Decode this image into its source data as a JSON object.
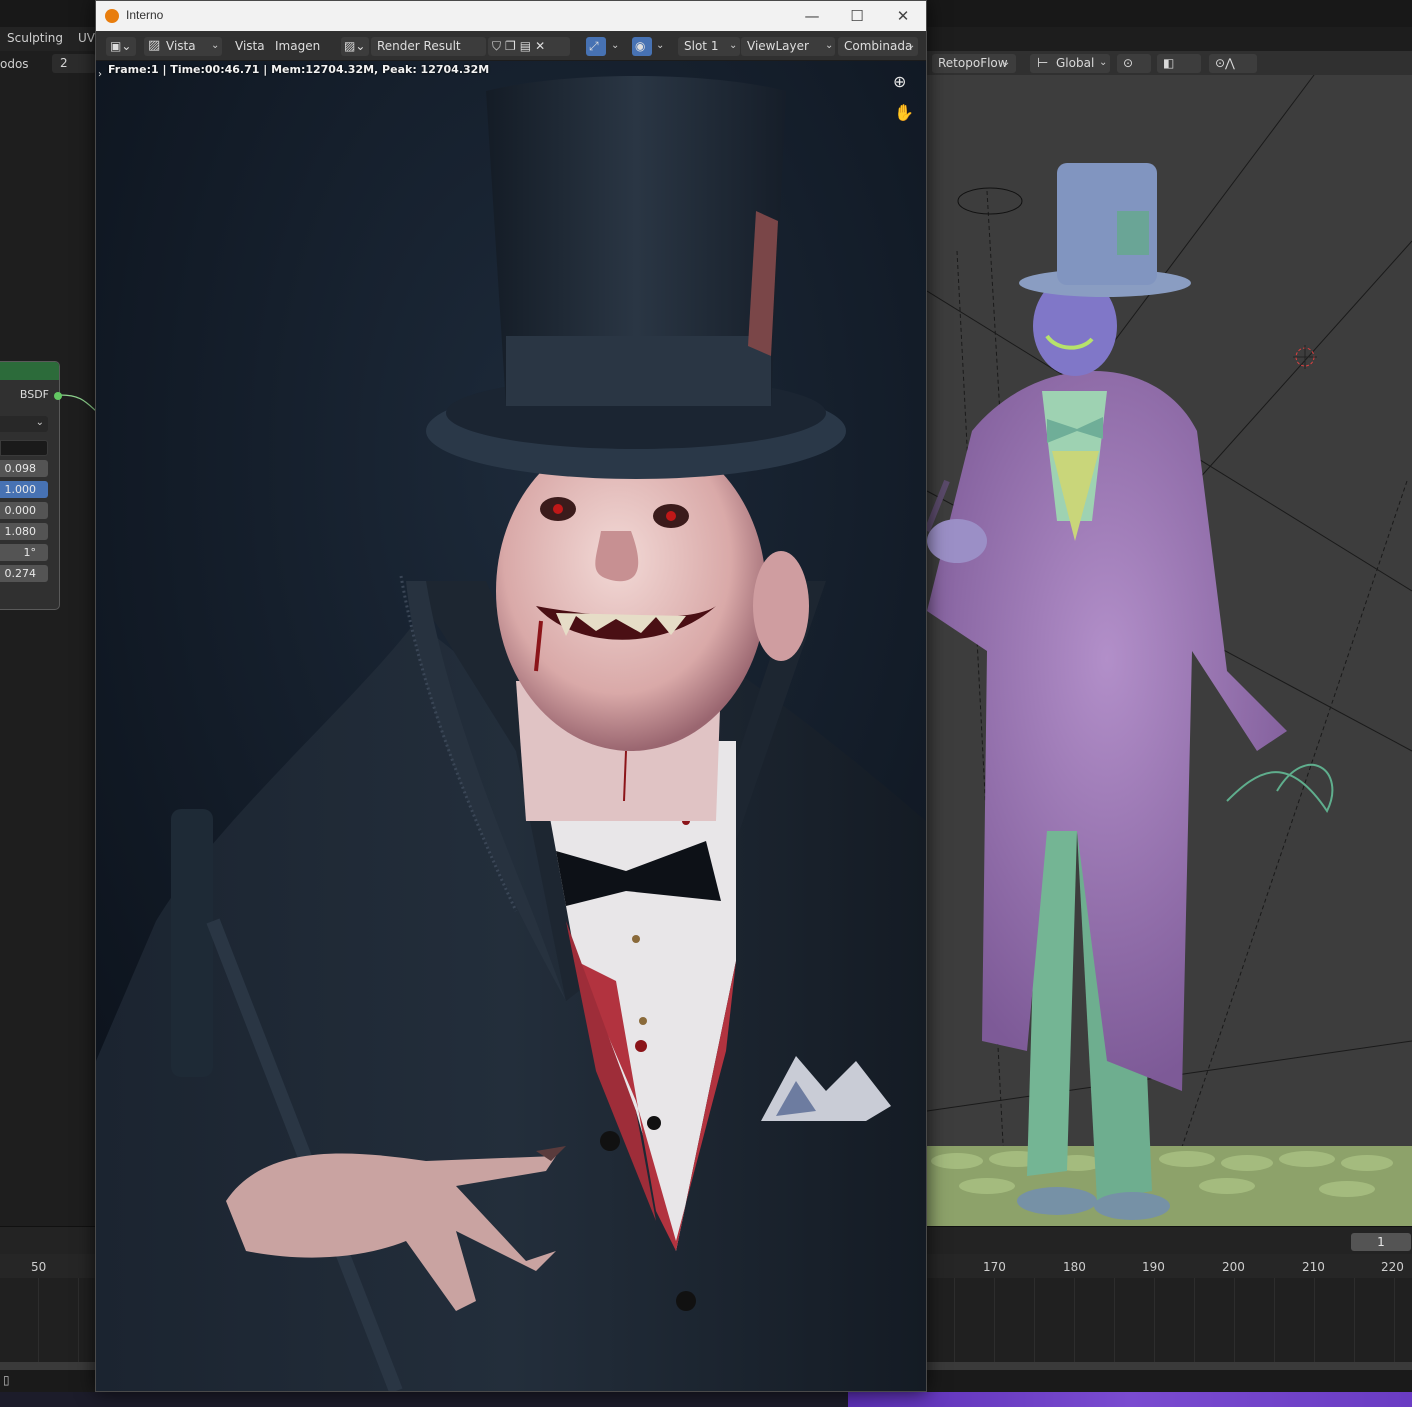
{
  "workspace": {
    "tabs": [
      "Sculpting",
      "UV"
    ],
    "left_header_label": "odos",
    "left_header_value": "2"
  },
  "node": {
    "output_label": "BSDF",
    "values": [
      "0.098",
      "1.000",
      "0.000",
      "1.080",
      "1°",
      "0.274"
    ],
    "active_index": 1,
    "header_color": "#2c6b3a"
  },
  "viewport": {
    "addon_menu": "RetopoFlow",
    "orientation": "Global"
  },
  "timeline": {
    "current_frame": "1",
    "ticks_left": [
      "50"
    ],
    "ticks_right": [
      "170",
      "180",
      "190",
      "200",
      "210",
      "220"
    ]
  },
  "render_window": {
    "title": "Interno",
    "header": {
      "view_menu_1": "Vista",
      "view_menu_2": "Vista",
      "image_menu": "Imagen",
      "image_name": "Render Result",
      "slot": "Slot 1",
      "view_layer": "ViewLayer",
      "pass": "Combinada"
    },
    "frame_info": "Frame:1 | Time:00:46.71 | Mem:12704.32M, Peak: 12704.32M"
  },
  "colors": {
    "accent_blue": "#4772b3",
    "background": "#1d1d1d",
    "render_bg": "#0f1722"
  }
}
